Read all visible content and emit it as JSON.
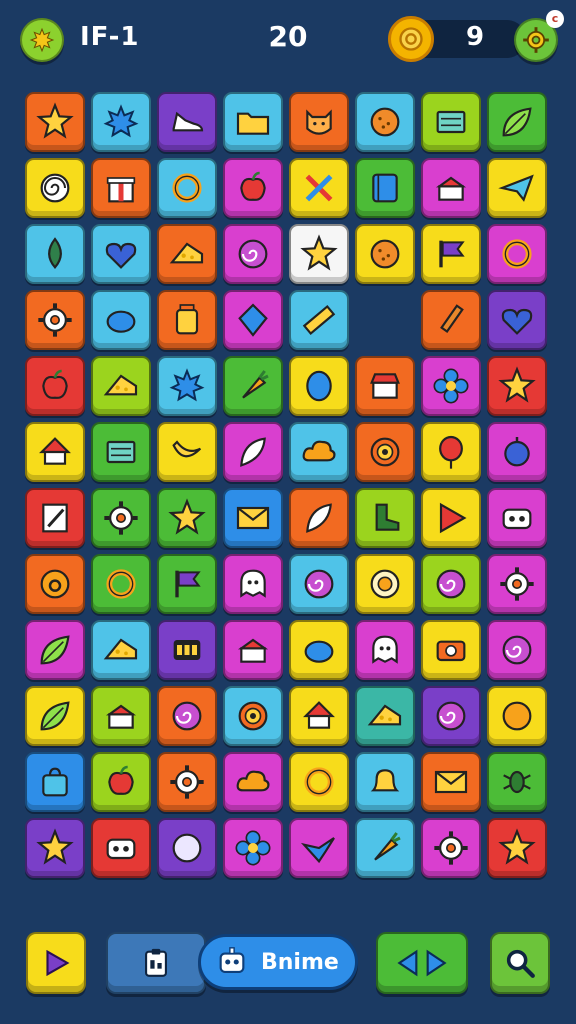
{
  "hud": {
    "level_label": "IF-1",
    "score": "20",
    "coins": "9",
    "badge": "c"
  },
  "bottom_bar": {
    "primary_label": "Bnime"
  },
  "colors": {
    "background": "#1b3a63",
    "orange": "#f26a21",
    "sky": "#4fc3e8",
    "purple": "#7a3fc8",
    "yellow": "#f7dc1b",
    "green": "#4cbc37",
    "magenta": "#d93fcf",
    "red": "#e53935",
    "lime": "#9bd41e",
    "blue": "#2e8ee8",
    "teal": "#3bb7a6"
  },
  "board": {
    "columns": 8,
    "rows": 12,
    "tiles": [
      [
        "orange:star-icon",
        "sky:splat-icon",
        "purple:shoe-icon",
        "sky:folder-icon",
        "orange:cat-face-icon",
        "sky:cookie-icon",
        "lime:book-icon",
        "green:leaf-icon"
      ],
      [
        "yellow:spiral-icon",
        "orange:gift-icon",
        "sky:ring-icon",
        "magenta:apple-icon",
        "yellow:scissors-icon",
        "green:notebook-icon",
        "magenta:cake-icon",
        "yellow:plane-icon"
      ],
      [
        "sky:drop-icon",
        "sky:heart-icon",
        "orange:cheese-icon",
        "magenta:swirl-icon",
        "white:star-icon",
        "yellow:cookie-icon",
        "yellow:flag-icon",
        "magenta:ring-icon"
      ],
      [
        "orange:gear-icon",
        "sky:blob-icon",
        "orange:jar-icon",
        "magenta:diamond-icon",
        "sky:ruler-icon",
        "empty",
        "orange:pencil-icon",
        "purple:heart-icon"
      ],
      [
        "red:apple-icon",
        "lime:cheese-icon",
        "sky:splat-icon",
        "green:carrot-icon",
        "yellow:egg-icon",
        "orange:shop-icon",
        "magenta:flower-icon",
        "red:star-icon"
      ],
      [
        "yellow:house-icon",
        "green:book-icon",
        "yellow:banana-icon",
        "magenta:feather-icon",
        "sky:cloud-icon",
        "orange:target-icon",
        "yellow:balloon-icon",
        "magenta:plum-icon"
      ],
      [
        "red:note-icon",
        "green:gear-icon",
        "green:star-icon",
        "blue:envelope-icon",
        "orange:feather-icon",
        "lime:boot-icon",
        "yellow:play-icon",
        "magenta:robot-icon"
      ],
      [
        "orange:face-icon",
        "green:ring-icon",
        "green:flag-icon",
        "magenta:ghost-icon",
        "sky:swirl-icon",
        "yellow:coin-icon",
        "lime:swirl-icon",
        "magenta:gear-icon"
      ],
      [
        "magenta:leaf-icon",
        "sky:cheese-icon",
        "purple:abacus-icon",
        "magenta:cake-icon",
        "yellow:blob-icon",
        "magenta:ghost-icon",
        "yellow:camera-icon",
        "magenta:swirl-icon"
      ],
      [
        "yellow:leaf-icon",
        "lime:cake-icon",
        "orange:swirl-icon",
        "sky:target-icon",
        "yellow:house-icon",
        "teal:cheese-icon",
        "purple:swirl-icon",
        "yellow:orange-icon"
      ],
      [
        "blue:bag-icon",
        "lime:apple-icon",
        "orange:gear-icon",
        "magenta:cloud-icon",
        "yellow:ring-icon",
        "sky:bell-icon",
        "orange:envelope-icon",
        "green:bug-icon"
      ],
      [
        "purple:star-icon",
        "red:robot-icon",
        "purple:ball-icon",
        "magenta:flower-icon",
        "magenta:bird-icon",
        "sky:carrot-icon",
        "magenta:gear-icon",
        "red:star-icon"
      ]
    ]
  }
}
